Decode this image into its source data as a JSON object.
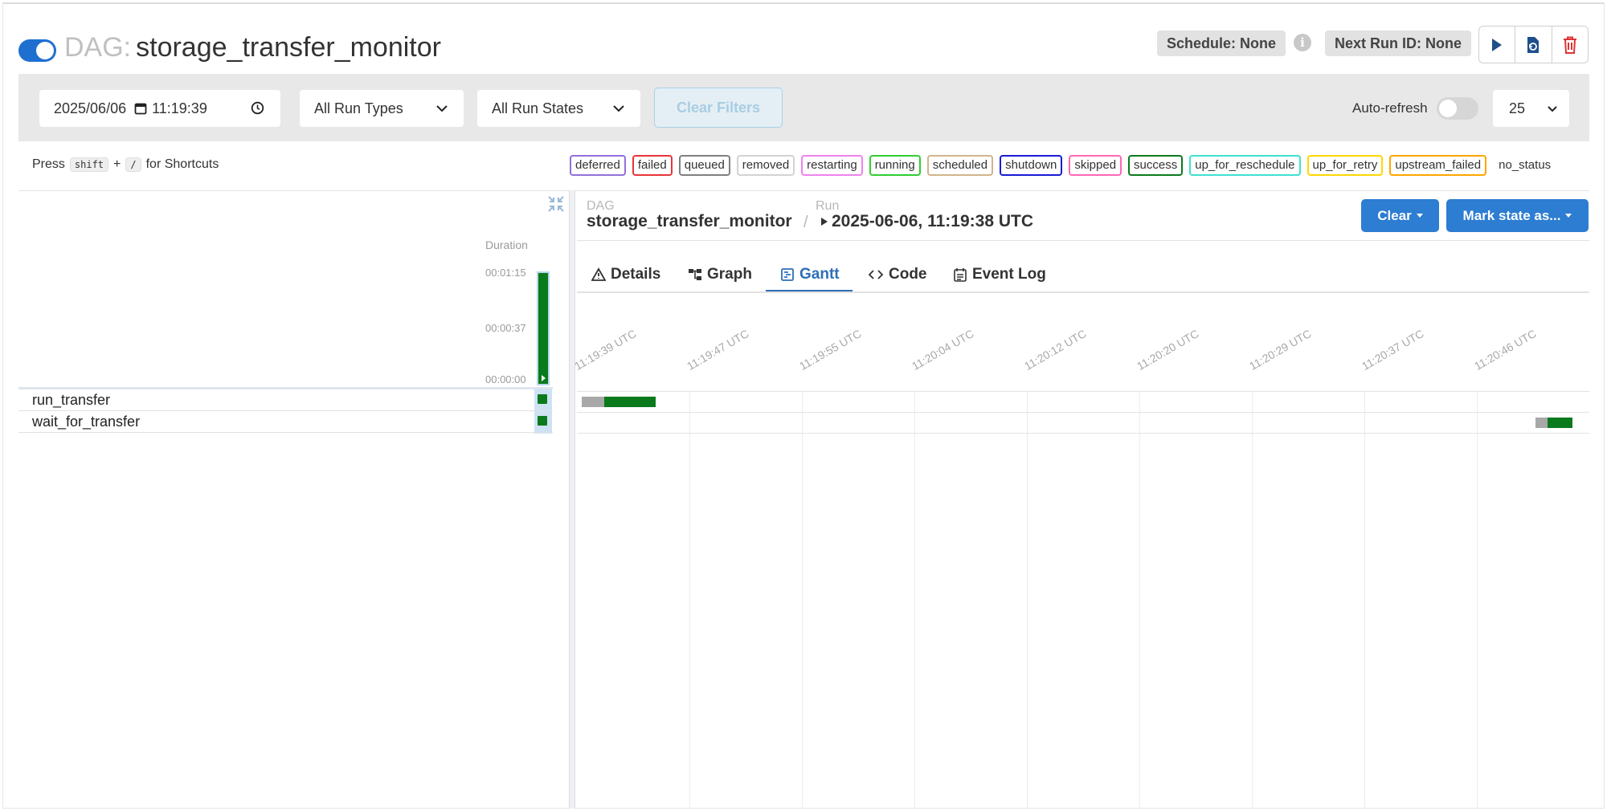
{
  "header": {
    "dag_prefix": "DAG:",
    "dag_id": "storage_transfer_monitor",
    "schedule": "Schedule: None",
    "next_run": "Next Run ID: None",
    "info_icon": "i"
  },
  "filters": {
    "date": "2025/06/06",
    "time": "11:19:39",
    "run_types": "All Run Types",
    "run_states": "All Run States",
    "clear_filters": "Clear Filters",
    "auto_refresh": "Auto-refresh",
    "num_runs": "25"
  },
  "shortcuts": {
    "press": "Press",
    "key1": "shift",
    "plus": "+",
    "key2": "/",
    "suffix": "for Shortcuts"
  },
  "legend": [
    {
      "label": "deferred",
      "color": "#9370db"
    },
    {
      "label": "failed",
      "color": "#e8343a"
    },
    {
      "label": "queued",
      "color": "#808080"
    },
    {
      "label": "removed",
      "color": "#d3d3d3"
    },
    {
      "label": "restarting",
      "color": "#ee82ee"
    },
    {
      "label": "running",
      "color": "#32cd32"
    },
    {
      "label": "scheduled",
      "color": "#d2b48c"
    },
    {
      "label": "shutdown",
      "color": "#1a1ad6"
    },
    {
      "label": "skipped",
      "color": "#ff69b4"
    },
    {
      "label": "success",
      "color": "#0a7a1c"
    },
    {
      "label": "up_for_reschedule",
      "color": "#40e0d0"
    },
    {
      "label": "up_for_retry",
      "color": "#ffd700"
    },
    {
      "label": "upstream_failed",
      "color": "#ffa500"
    },
    {
      "label": "no_status",
      "color": "none"
    }
  ],
  "grid": {
    "duration_label": "Duration",
    "ticks": [
      "00:01:15",
      "00:00:37",
      "00:00:00"
    ],
    "tasks": [
      "run_transfer",
      "wait_for_transfer"
    ]
  },
  "details": {
    "dag_label": "DAG",
    "dag_id": "storage_transfer_monitor",
    "separator": "/",
    "run_label": "Run",
    "run_id": "2025-06-06, 11:19:38 UTC",
    "clear_button": "Clear",
    "mark_state_button": "Mark state as..."
  },
  "tabs": [
    {
      "label": "Details",
      "icon": "warning-triangle-icon"
    },
    {
      "label": "Graph",
      "icon": "graph-icon"
    },
    {
      "label": "Gantt",
      "icon": "gantt-icon",
      "active": true
    },
    {
      "label": "Code",
      "icon": "code-icon"
    },
    {
      "label": "Event Log",
      "icon": "event-log-icon"
    }
  ],
  "gantt": {
    "time_labels": [
      "11:19:39 UTC",
      "11:19:47 UTC",
      "11:19:55 UTC",
      "11:20:04 UTC",
      "11:20:12 UTC",
      "11:20:20 UTC",
      "11:20:29 UTC",
      "11:20:37 UTC",
      "11:20:46 UTC"
    ],
    "tasks": [
      {
        "name": "run_transfer",
        "state": "success"
      },
      {
        "name": "wait_for_transfer",
        "state": "success"
      }
    ],
    "queued_color": "#a8a8a8",
    "success_color": "#0a7a1c"
  }
}
